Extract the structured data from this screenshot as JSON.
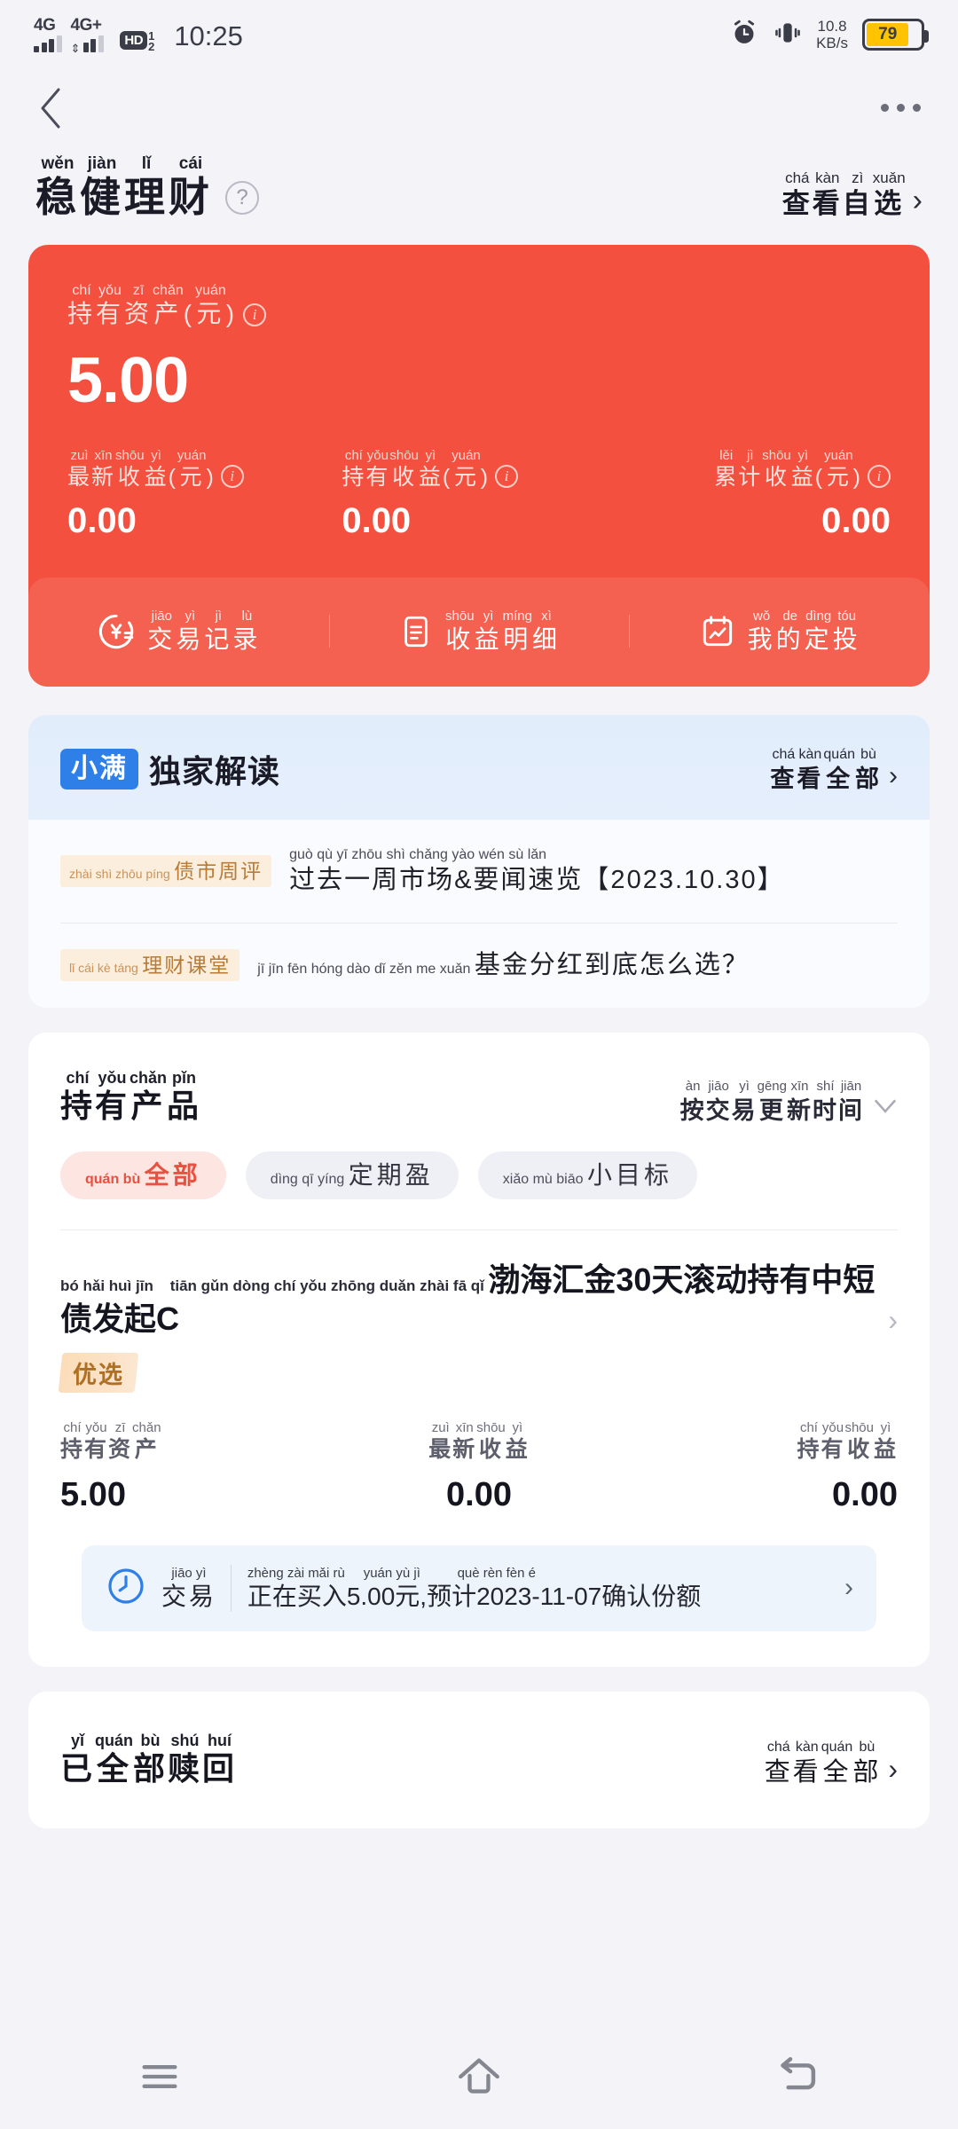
{
  "status_bar": {
    "network_1": "4G",
    "network_2": "4G+",
    "hd_label": "HD",
    "hd_sub": "1",
    "hd_sub2": "2",
    "time": "10:25",
    "net_speed_value": "10.8",
    "net_speed_unit": "KB/s",
    "battery_percent": "79",
    "battery_color": "#FFC300"
  },
  "top_nav": {
    "back_icon": "chevron-left-icon",
    "more_icon": "more-horizontal-icon"
  },
  "page_head": {
    "title_pinyin": [
      "wěn",
      "jiàn",
      "lǐ",
      "cái"
    ],
    "title_chars": [
      "稳",
      "健",
      "理",
      "财"
    ],
    "help_icon": "question-mark-icon",
    "right_pinyin": [
      "chá",
      "kàn",
      "zì",
      "xuǎn"
    ],
    "right_chars": [
      "查",
      "看",
      "自",
      "选"
    ],
    "right_chevron": "chevron-right-icon"
  },
  "asset_card": {
    "background_color": "#F4503F",
    "main_label_pinyin": [
      "chí",
      "yǒu",
      "zī",
      "chǎn",
      "yuán"
    ],
    "main_label_chars": [
      "持",
      "有",
      "资",
      "产",
      "(",
      "元",
      ")"
    ],
    "main_label_text": "持有资产(元)",
    "main_info_icon": "info-icon",
    "main_value": "5.00",
    "stats": [
      {
        "label_pinyin": [
          "zuì",
          "xīn",
          "shōu",
          "yì",
          "yuán"
        ],
        "label_text": "最新收益(元)",
        "info_icon": "info-icon",
        "value": "0.00"
      },
      {
        "label_pinyin": [
          "chí",
          "yǒu",
          "shōu",
          "yì",
          "yuán"
        ],
        "label_text": "持有收益(元)",
        "info_icon": "info-icon",
        "value": "0.00"
      },
      {
        "label_pinyin": [
          "lěi",
          "jì",
          "shōu",
          "yì",
          "yuán"
        ],
        "label_text": "累计收益(元)",
        "info_icon": "info-icon",
        "value": "0.00"
      }
    ],
    "actions": [
      {
        "icon": "yuan-record-icon",
        "pinyin": [
          "jiāo",
          "yì",
          "jì",
          "lù"
        ],
        "text": "交易记录"
      },
      {
        "icon": "document-list-icon",
        "pinyin": [
          "shōu",
          "yì",
          "míng",
          "xì"
        ],
        "text": "收益明细"
      },
      {
        "icon": "calendar-chart-icon",
        "pinyin": [
          "wǒ",
          "de",
          "dìng",
          "tóu"
        ],
        "text": "我的定投"
      }
    ]
  },
  "insight": {
    "badge": "小满",
    "badge_color": "#2E7FE8",
    "title": "独家解读",
    "more_pinyin": [
      "chá",
      "kàn",
      "quán",
      "bù"
    ],
    "more_text": "查看全部",
    "more_chevron": "chevron-right-icon",
    "items": [
      {
        "tag_pinyin": [
          "zhài",
          "shì",
          "zhōu",
          "píng"
        ],
        "tag_text": "债市周评",
        "title_pinyin": [
          "guò",
          "qù",
          "yī",
          "zhōu",
          "shì",
          "chǎng",
          "yào",
          "wén",
          "sù",
          "lǎn"
        ],
        "title_text": "过去一周市场&要闻速览【2023.10.30】"
      },
      {
        "tag_pinyin": [
          "lǐ",
          "cái",
          "kè",
          "táng"
        ],
        "tag_text": "理财课堂",
        "title_pinyin": [
          "jī",
          "jīn",
          "fēn",
          "hóng",
          "dào",
          "dǐ",
          "zěn",
          "me",
          "xuǎn"
        ],
        "title_text": "基金分红到底怎么选？"
      }
    ]
  },
  "holdings": {
    "header_pinyin": [
      "chí",
      "yǒu",
      "chǎn",
      "pǐn"
    ],
    "header_text": "持有产品",
    "sort_pinyin": [
      "àn",
      "jiāo",
      "yì",
      "gēng",
      "xīn",
      "shí",
      "jiān"
    ],
    "sort_text": "按交易更新时间",
    "sort_chevron": "chevron-down-icon",
    "chips": [
      {
        "pinyin": [
          "quán",
          "bù"
        ],
        "text": "全部",
        "active": true
      },
      {
        "pinyin": [
          "dìng",
          "qī",
          "yíng"
        ],
        "text": "定期盈",
        "active": false
      },
      {
        "pinyin": [
          "xiǎo",
          "mù",
          "biāo"
        ],
        "text": "小目标",
        "active": false
      }
    ],
    "product": {
      "name_pinyin_1": [
        "bó",
        "hǎi",
        "huì",
        "jīn"
      ],
      "name_pinyin_2": [
        "tiān",
        "gǔn",
        "dòng",
        "chí",
        "yǒu",
        "zhōng",
        "duǎn",
        "zhài",
        "fā",
        "qǐ"
      ],
      "name_text": "渤海汇金30天滚动持有中短债发起C",
      "chevron": "chevron-right-icon",
      "badge": "优选",
      "badge_text_color": "#b07023",
      "stats": [
        {
          "label_pinyin": [
            "chí",
            "yǒu",
            "zī",
            "chǎn"
          ],
          "label_text": "持有资产",
          "value": "5.00"
        },
        {
          "label_pinyin": [
            "zuì",
            "xīn",
            "shōu",
            "yì"
          ],
          "label_text": "最新收益",
          "value": "0.00"
        },
        {
          "label_pinyin": [
            "chí",
            "yǒu",
            "shōu",
            "yì"
          ],
          "label_text": "持有收益",
          "value": "0.00"
        }
      ],
      "transaction": {
        "icon": "clock-icon",
        "label_pinyin": [
          "jiāo",
          "yì"
        ],
        "label_text": "交易",
        "detail_pinyin": [
          "zhèng",
          "zài",
          "mǎi",
          "rù",
          "yuán",
          "yù",
          "jì",
          "què",
          "rèn",
          "fèn",
          "é"
        ],
        "detail_text": "正在买入5.00元,预计2023-11-07确认份额",
        "chevron": "chevron-right-icon"
      }
    }
  },
  "redeemed": {
    "title_pinyin": [
      "yǐ",
      "quán",
      "bù",
      "shú",
      "huí"
    ],
    "title_text": "已全部赎回",
    "more_pinyin": [
      "chá",
      "kàn",
      "quán",
      "bù"
    ],
    "more_text": "查看全部",
    "more_chevron": "chevron-right-icon"
  },
  "system_nav": {
    "recents_icon": "menu-icon",
    "home_icon": "home-icon",
    "back_icon": "back-arrow-icon"
  }
}
